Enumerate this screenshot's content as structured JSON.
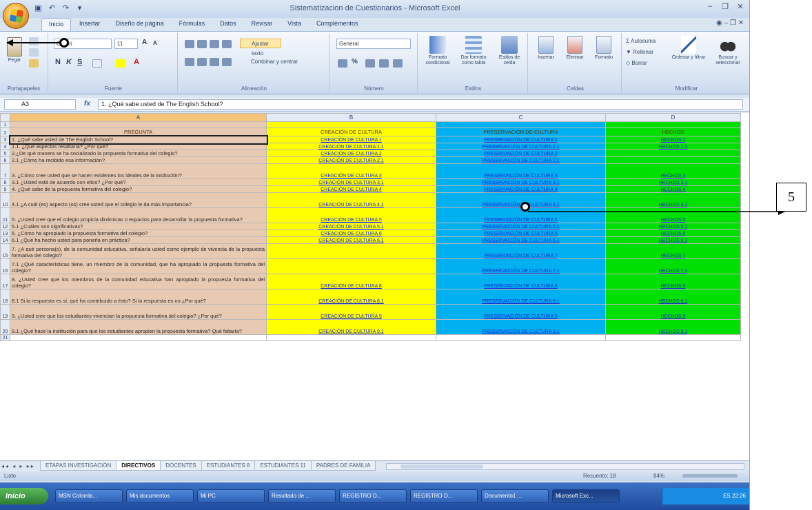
{
  "app": {
    "window_title": "Sistematizacion de Cuestionarios - Microsoft Excel",
    "window_controls": [
      "–",
      "❐",
      "✕"
    ],
    "help_controls": "◉  –  ❐  ✕"
  },
  "ribbon": {
    "tabs": [
      "Inicio",
      "Insertar",
      "Diseño de página",
      "Fórmulas",
      "Datos",
      "Revisar",
      "Vista",
      "Complementos"
    ],
    "active_tab": "Inicio",
    "clipboard": {
      "paste": "Pegar",
      "label": "Portapapeles"
    },
    "font": {
      "name": "Calibri",
      "size": "11",
      "label": "Fuente"
    },
    "alignment": {
      "wrap": "Ajustar texto",
      "merge": "Combinar y centrar",
      "label": "Alineación"
    },
    "number": {
      "format": "General",
      "label": "Número"
    },
    "styles": {
      "conditional": "Formato condicional",
      "as_table": "Dar formato como tabla",
      "cell_styles": "Estilos de celda",
      "label": "Estilos"
    },
    "cells": {
      "insert": "Insertar",
      "delete": "Eliminar",
      "format": "Formato",
      "label": "Celdas"
    },
    "editing": {
      "autosum": "Autosuma",
      "fill": "Rellenar",
      "clear": "Borrar",
      "sort": "Ordenar y filtrar",
      "find": "Buscar y seleccionar",
      "label": "Modificar"
    }
  },
  "formula_bar": {
    "cell_ref": "A3",
    "fx": "fx",
    "content": "1. ¿Qué sabe usted de The English School?"
  },
  "sheet": {
    "col_headers": [
      "A",
      "B",
      "C",
      "D"
    ],
    "header_row": {
      "num": "2",
      "A": "PREGUNTA",
      "B": "CREACIÓN DE CULTURA",
      "C": "PRESERVACIÓN DE CULTURA",
      "D": "HECHOS"
    },
    "first_row_num": "1",
    "last_row_num": "21",
    "rows": [
      {
        "num": "3",
        "A": "1. ¿Qué sabe usted de The English School?",
        "B": "CREACIÓN DE CULTURA 1",
        "C": "PRESERVACIÓN DE CULTURA 1",
        "D": "HECHOS 1"
      },
      {
        "num": "4",
        "A": "1.1. ¿Qué aspectos resaltaría? ¿Por qué?",
        "B": "CREACIÓN DE CULTURA 1.1",
        "C": "PRESERVACIÓN DE CULTURA 1.1",
        "D": "HECHOS 1.1"
      },
      {
        "num": "5",
        "A": "2.¿De qué manera se ha socializado la propuesta formativa del colegio?",
        "B": "CREACIÓN DE CULTURA 2",
        "C": "PRESERVACIÓN DE CULTURA 2",
        "D": ""
      },
      {
        "num": "6",
        "A": "2.1 ¿Cómo ha recibido esa información?",
        "B": "CREACIÓN DE CULTURA 2.1",
        "C": "PRESERVACIÓN DE CULTURA 2.1",
        "D": ""
      },
      {
        "num": "7",
        "A": "3. ¿Cómo cree usted que se hacen evidentes los ideales de la institución?",
        "B": "CREACIÓN DE CULTURA 3",
        "C": "PRESERVACIÓN DE CULTURA 3",
        "D": "HECHOS 3"
      },
      {
        "num": "8",
        "A": "3.1 ¿Usted está de acuerdo con ellos? ¿Por qué?",
        "B": "CREACIÓN DE CULTURA 3.1",
        "C": "PRESERVACIÓN DE CULTURA 3.1",
        "D": "HECHOS 3.1"
      },
      {
        "num": "9",
        "A": "4. ¿Qué sabe de la propuesta formativa del colegio?",
        "B": "CREACIÓN DE CULTURA 4",
        "C": "PRESERVACIÓN DE CULTURA 4",
        "D": "HECHOS 4"
      },
      {
        "num": "10",
        "A": "4.1 ¿A cuál (es) aspecto (os) cree usted que el colegio le da más importancia?",
        "B": "CREACIÓN DE CULTURA 4.1",
        "C": "PRESERVACIÓN DE CULTURA 4.1",
        "D": "HECHOS 4.1"
      },
      {
        "num": "11",
        "A": "5. ¿Usted cree que el colegio propicia dinámicas o espacios para desarrollar la propuesta formativa?",
        "B": "CREACIÓN DE CULTURA 5",
        "C": "PRESERVACIÓN DE CULTURA 5",
        "D": "HECHOS 5"
      },
      {
        "num": "12",
        "A": "5.1 ¿Cuáles son significativas?",
        "B": "CREACIÓN DE CULTURA 5.1",
        "C": "PRESERVACIÓN DE CULTURA 5.1",
        "D": "HECHOS 5.1"
      },
      {
        "num": "13",
        "A": "6. ¿Cómo ha apropiado la propuesta formativa del colegio?",
        "B": "CREACIÓN DE CULTURA 6",
        "C": "PRESERVACIÓN DE CULTURA 6",
        "D": "HECHOS 6"
      },
      {
        "num": "14",
        "A": "6.1 ¿Qué ha hecho usted para ponerla en práctica?",
        "B": "CREACIÓN DE CULTURA 6.1",
        "C": "PRESERVACIÓN DE CULTURA 6.1",
        "D": "HECHOS 6.1"
      },
      {
        "num": "15",
        "A": "7. ¿A qué persona(s), de la comunidad educativa, señalaría usted como ejemplo de vivencia de la propuesta formativa del colegio?",
        "B": "",
        "C": "PRESERVACIÓN DE CULTURA 7",
        "D": "HECHOS 7"
      },
      {
        "num": "16",
        "A": "7.1 ¿Qué características tiene, un miembro de la comunidad, que ha apropiado la propuesta formativa del colegio?",
        "B": "",
        "C": "PRESERVACIÓN DE CULTURA 7.1",
        "D": "HECHOS 7.1"
      },
      {
        "num": "17",
        "A": "8. ¿Usted cree que los miembros de la comunidad educativa han apropiado la propuesta formativa del colegio?",
        "B": "CREACIÓN DE CULTURA 8",
        "C": "PRESERVACIÓN DE CULTURA 8",
        "D": "HECHOS 8"
      },
      {
        "num": "18",
        "A": "8.1 Si la respuesta es sí, qué ha contribuido a ésto? Si la respuesta es no ¿Por qué?",
        "B": "CREACIÓN DE CULTURA 8.1",
        "C": "PRESERVACIÓN DE CULTURA 8.1",
        "D": "HECHOS 8.1"
      },
      {
        "num": "19",
        "A": "9. ¿Usted cree que los estudiantes vivencian la propuesta formativa del colegio? ¿Por qué?",
        "B": "CREACIÓN DE CULTURA 9",
        "C": "PRESERVACIÓN DE CULTURA 9",
        "D": "HECHOS 9"
      },
      {
        "num": "20",
        "A": "9.1 ¿Qué hace la institución para que los estudiantes apropien la propuesta formativa? Qué faltaría?",
        "B": "CREACIÓN DE CULTURA 9.1",
        "C": "PRESERVACIÓN DE CULTURA 9.1",
        "D": "HECHOS 9.1"
      }
    ]
  },
  "sheet_tabs": {
    "nav": "◂◂ ◂ ▸ ▸▸",
    "tabs": [
      "ETAPAS INVESTIGACIÓN",
      "DIRECTIVOS",
      "DOCENTES",
      "ESTUDIANTES 8",
      "ESTUDIANTES 11",
      "PADRES DE FAMILIA"
    ],
    "active": "DIRECTIVOS"
  },
  "status_bar": {
    "ready": "Listo",
    "count": "Recuento: 18",
    "zoom": "84%"
  },
  "taskbar": {
    "start": "Inicio",
    "items": [
      "MSN Colombi...",
      "Mis documentos",
      "Mi PC",
      "Resultado de ...",
      "REGISTRO D...",
      "REGISTRO D...",
      "Documento1 ...",
      "Microsoft Exc..."
    ],
    "active_index": 7,
    "clock": "ES  22:26"
  },
  "annotation": {
    "label": "5"
  }
}
